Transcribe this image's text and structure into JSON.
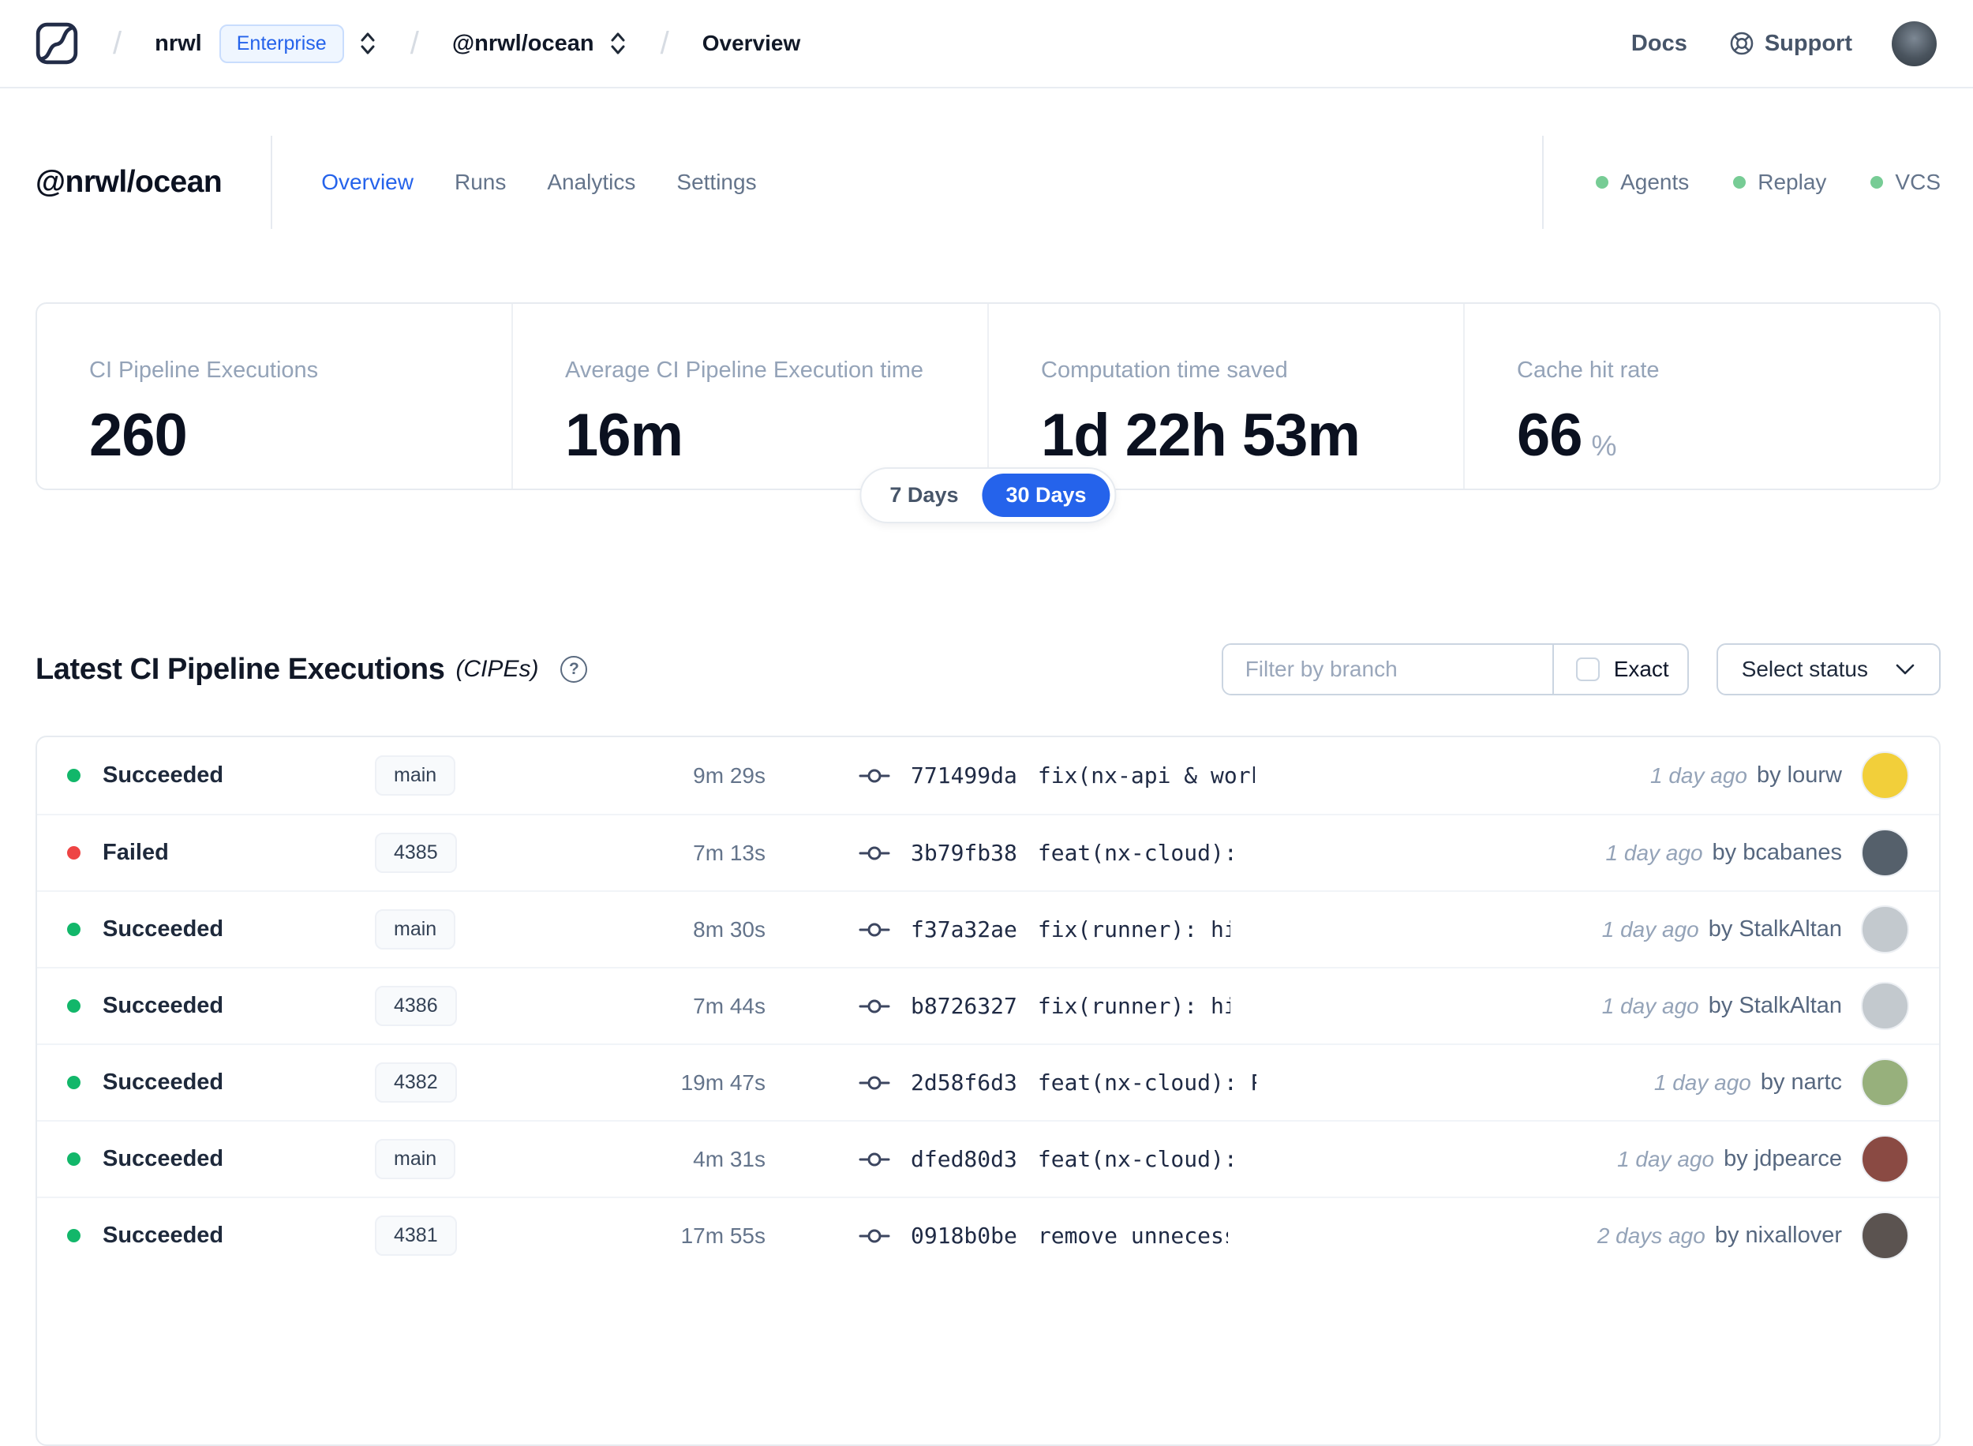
{
  "navbar": {
    "org": "nrwl",
    "org_badge": "Enterprise",
    "workspace": "@nrwl/ocean",
    "page": "Overview",
    "docs_label": "Docs",
    "support_label": "Support"
  },
  "header": {
    "title": "@nrwl/ocean",
    "tabs": [
      {
        "label": "Overview",
        "active": true
      },
      {
        "label": "Runs",
        "active": false
      },
      {
        "label": "Analytics",
        "active": false
      },
      {
        "label": "Settings",
        "active": false
      }
    ],
    "statuses": [
      {
        "label": "Agents",
        "color": "#77cc95"
      },
      {
        "label": "Replay",
        "color": "#77cc95"
      },
      {
        "label": "VCS",
        "color": "#77cc95"
      }
    ]
  },
  "stats": {
    "cards": [
      {
        "label": "CI Pipeline Executions",
        "value": "260",
        "suffix": ""
      },
      {
        "label": "Average CI Pipeline Execution time",
        "value": "16m",
        "suffix": ""
      },
      {
        "label": "Computation time saved",
        "value": "1d 22h 53m",
        "suffix": ""
      },
      {
        "label": "Cache hit rate",
        "value": "66",
        "suffix": "%"
      }
    ],
    "range_toggle": {
      "options": [
        "7 Days",
        "30 Days"
      ],
      "selected": "30 Days"
    }
  },
  "cipe": {
    "title": "Latest CI Pipeline Executions",
    "subtitle": "(CIPEs)",
    "filter_placeholder": "Filter by branch",
    "exact_label": "Exact",
    "status_dropdown_label": "Select status",
    "rows": [
      {
        "status": "Succeeded",
        "status_color": "#12b76a",
        "branch": "main",
        "duration": "9m 29s",
        "commit": "771499da",
        "message": "fix(nx-api & workflows): close workfl…",
        "time": "1 day ago",
        "author": "by lourw",
        "avatar_color": "#f2cf3a"
      },
      {
        "status": "Failed",
        "status_color": "#ee4444",
        "branch": "4385",
        "duration": "7m 13s",
        "commit": "3b79fb38",
        "message": "feat(nx-cloud): refactor UI component…",
        "time": "1 day ago",
        "author": "by bcabanes",
        "avatar_color": "#55606b"
      },
      {
        "status": "Succeeded",
        "status_color": "#12b76a",
        "branch": "main",
        "duration": "8m 30s",
        "commit": "f37a32ae",
        "message": "fix(runner): hide log upload errors b…",
        "time": "1 day ago",
        "author": "by StalkAltan",
        "avatar_color": "#c3c9ce"
      },
      {
        "status": "Succeeded",
        "status_color": "#12b76a",
        "branch": "4386",
        "duration": "7m 44s",
        "commit": "b8726327",
        "message": "fix(runner): hide log upload errors b…",
        "time": "1 day ago",
        "author": "by StalkAltan",
        "avatar_color": "#c3c9ce"
      },
      {
        "status": "Succeeded",
        "status_color": "#12b76a",
        "branch": "4382",
        "duration": "19m 47s",
        "commit": "2d58f6d3",
        "message": "feat(nx-cloud): PermissionError and N…",
        "time": "1 day ago",
        "author": "by nartc",
        "avatar_color": "#97b07c"
      },
      {
        "status": "Succeeded",
        "status_color": "#12b76a",
        "branch": "main",
        "duration": "4m 31s",
        "commit": "dfed80d3",
        "message": "feat(nx-cloud): add time-saved end po…",
        "time": "1 day ago",
        "author": "by jdpearce",
        "avatar_color": "#8a4a43"
      },
      {
        "status": "Succeeded",
        "status_color": "#12b76a",
        "branch": "4381",
        "duration": "17m 55s",
        "commit": "0918b0be",
        "message": "remove unnecessary invalidation",
        "time": "2 days ago",
        "author": "by nixallover",
        "avatar_color": "#5b5350"
      }
    ]
  }
}
